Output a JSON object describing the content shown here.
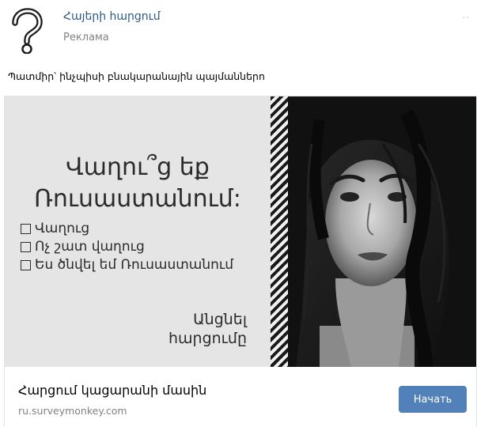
{
  "header": {
    "group_name": "Հայերի հարցում",
    "sub_label": "Реклама",
    "more": "··"
  },
  "post_text": "Պատմիր՝ ինչպիսի բնակարանային պայմաններո",
  "ad": {
    "question_line1": "Վաղու՞ց եք",
    "question_line2": "Ռուսաստանում:",
    "options": [
      "Վաղուց",
      "Ոչ շատ վաղուց",
      "Ես ծնվել եմ Ռուսաստանում"
    ],
    "skip_line1": "Անցնել",
    "skip_line2": "հարցումը"
  },
  "card": {
    "title": "Հարցում կացարանի մասին",
    "domain": "ru.surveymonkey.com",
    "cta_label": "Начать"
  },
  "colors": {
    "link": "#2a5885",
    "button": "#5181b8",
    "muted": "#828282"
  }
}
